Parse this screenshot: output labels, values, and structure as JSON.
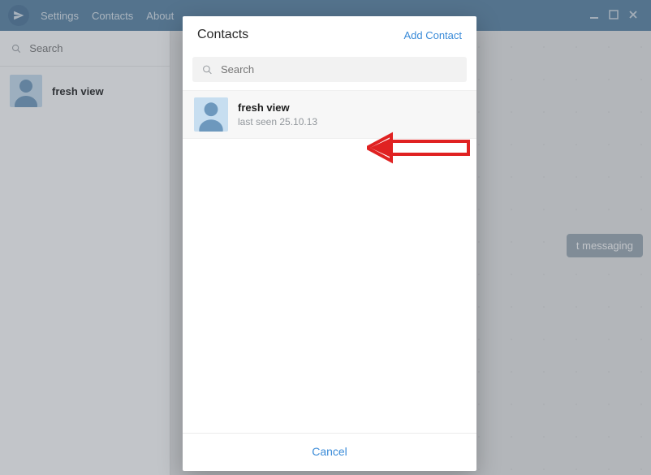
{
  "titlebar": {
    "menu": {
      "settings": "Settings",
      "contacts": "Contacts",
      "about": "About"
    }
  },
  "sidebar": {
    "search_placeholder": "Search",
    "chats": [
      {
        "name": "fresh view"
      }
    ]
  },
  "chatarea": {
    "start_messaging": "t messaging"
  },
  "modal": {
    "title": "Contacts",
    "add_contact": "Add Contact",
    "search_placeholder": "Search",
    "contacts": [
      {
        "name": "fresh view",
        "status": "last seen 25.10.13"
      }
    ],
    "cancel": "Cancel"
  }
}
